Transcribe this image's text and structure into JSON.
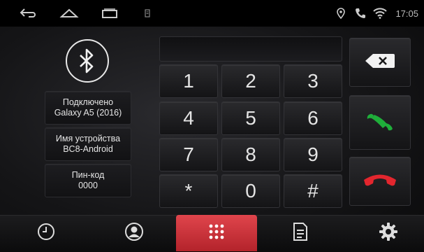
{
  "statusbar": {
    "time": "17:05",
    "icons": [
      "back-icon",
      "home-icon",
      "recents-icon",
      "notification-icon",
      "location-icon",
      "phone-icon",
      "wifi-icon"
    ]
  },
  "bluetooth": {
    "icon": "bluetooth-icon",
    "connection_status": "Подключено",
    "connected_device": "Galaxy A5 (2016)",
    "device_name_label": "Имя устройства",
    "device_name_value": "BC8-Android",
    "pin_label": "Пин-код",
    "pin_value": "0000"
  },
  "dialer": {
    "display_value": "",
    "keys": [
      "1",
      "2",
      "3",
      "4",
      "5",
      "6",
      "7",
      "8",
      "9",
      "*",
      "0",
      "#"
    ],
    "backspace_icon": "backspace-icon",
    "call_icon": "call-accept-icon",
    "hangup_icon": "call-end-icon",
    "accept_color": "#1fae3a",
    "hangup_color": "#e3262e"
  },
  "tabs": [
    {
      "icon": "call-history-icon"
    },
    {
      "icon": "contacts-icon"
    },
    {
      "icon": "dialpad-icon",
      "active": true
    },
    {
      "icon": "messages-icon"
    },
    {
      "icon": "settings-icon"
    }
  ],
  "accent_color": "#d8353d"
}
